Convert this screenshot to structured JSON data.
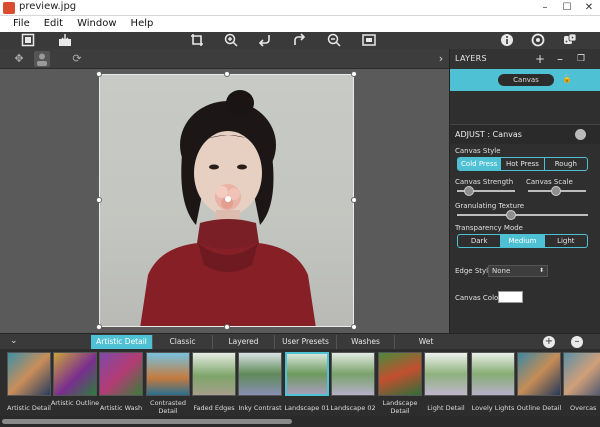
{
  "window": {
    "title": "preview.jpg"
  },
  "menu": {
    "items": [
      "File",
      "Edit",
      "Window",
      "Help"
    ]
  },
  "layers": {
    "title": "LAYERS",
    "layer_name": "Canvas"
  },
  "adjust": {
    "title": "ADJUST : Canvas",
    "canvas_style_label": "Canvas Style",
    "canvas_style_options": [
      "Cold Press",
      "Hot Press",
      "Rough"
    ],
    "canvas_style_selected": "Cold Press",
    "canvas_strength_label": "Canvas Strength",
    "canvas_strength_value": 0.2,
    "canvas_scale_label": "Canvas Scale",
    "canvas_scale_value": 0.65,
    "granulating_label": "Granulating Texture",
    "granulating_value": 0.4,
    "transparency_label": "Transparency Mode",
    "transparency_options": [
      "Dark",
      "Medium",
      "Light"
    ],
    "transparency_selected": "Medium",
    "edge_style_label": "Edge Style",
    "edge_style_value": "None",
    "canvas_color_label": "Canvas Color",
    "canvas_color_value": "#ffffff"
  },
  "tabs": {
    "items": [
      "Artistic Detail",
      "Classic",
      "Layered",
      "User Presets",
      "Washes",
      "Wet"
    ],
    "active": "Artistic Detail"
  },
  "presets": [
    "Artistic Detail",
    "Artistic Outline",
    "Artistic Wash",
    "Contrasted Detail",
    "Faded Edges",
    "Inky Contrast",
    "Landscape 01",
    "Landscape 02",
    "Landscape Detail",
    "Light Detail",
    "Lovely Lights",
    "Outline Detail",
    "Overcas"
  ],
  "colors": {
    "accent": "#4fc1d4"
  }
}
